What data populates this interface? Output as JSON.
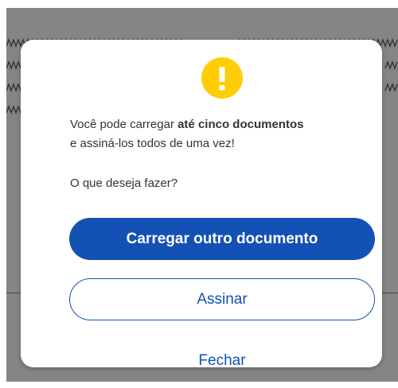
{
  "dialog": {
    "message_prefix": "Você pode carregar ",
    "message_bold": "até cinco documentos",
    "message_suffix": "e assiná-los todos de uma vez!",
    "question": "O que deseja fazer?",
    "primary_button": "Carregar outro documento",
    "secondary_button": "Assinar",
    "link_button": "Fechar",
    "icon": "exclamation-icon"
  },
  "colors": {
    "accent": "#1351b4",
    "warning": "#ffcd07",
    "overlay": "#858585"
  }
}
